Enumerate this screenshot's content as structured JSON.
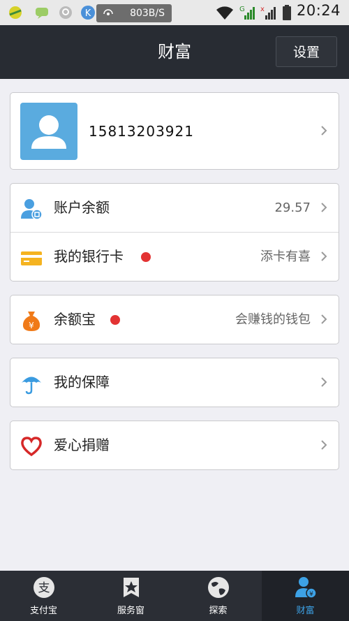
{
  "status_bar": {
    "speed": "803B/S",
    "time": "20:24"
  },
  "header": {
    "title": "财富",
    "settings_label": "设置"
  },
  "profile": {
    "phone": "15813203921"
  },
  "menu": {
    "balance": {
      "label": "账户余额",
      "value": "29.57"
    },
    "bank_card": {
      "label": "我的银行卡",
      "value": "添卡有喜"
    },
    "yuebao": {
      "label": "余额宝",
      "value": "会赚钱的钱包"
    },
    "insurance": {
      "label": "我的保障"
    },
    "charity": {
      "label": "爱心捐赠"
    }
  },
  "tabs": [
    {
      "label": "支付宝"
    },
    {
      "label": "服务窗"
    },
    {
      "label": "探索"
    },
    {
      "label": "财富"
    }
  ],
  "colors": {
    "header_bg": "#282c33",
    "accent": "#3da2e6",
    "badge": "#e33333",
    "page_bg": "#efeff4"
  }
}
